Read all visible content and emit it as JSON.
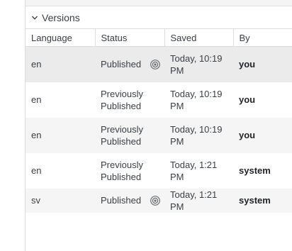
{
  "versions": {
    "title": "Versions",
    "columns": {
      "language": "Language",
      "status": "Status",
      "saved": "Saved",
      "by": "By"
    },
    "rows": [
      {
        "language": "en",
        "status_line1": "Published",
        "status_line2": "",
        "live": true,
        "saved_line1": "Today, 10:19",
        "saved_line2": "PM",
        "by": "you"
      },
      {
        "language": "en",
        "status_line1": "Previously",
        "status_line2": "Published",
        "live": false,
        "saved_line1": "Today, 10:19",
        "saved_line2": "PM",
        "by": "you"
      },
      {
        "language": "en",
        "status_line1": "Previously",
        "status_line2": "Published",
        "live": false,
        "saved_line1": "Today, 10:19",
        "saved_line2": "PM",
        "by": "you"
      },
      {
        "language": "en",
        "status_line1": "Previously",
        "status_line2": "Published",
        "live": false,
        "saved_line1": "Today, 1:21 PM",
        "saved_line2": "",
        "by": "system"
      },
      {
        "language": "sv",
        "status_line1": "Published",
        "status_line2": "",
        "live": true,
        "saved_line1": "Today, 1:21 PM",
        "saved_line2": "",
        "by": "system"
      }
    ]
  },
  "icons": {
    "collapse": "chevron-down-icon",
    "live": "broadcast-icon"
  }
}
